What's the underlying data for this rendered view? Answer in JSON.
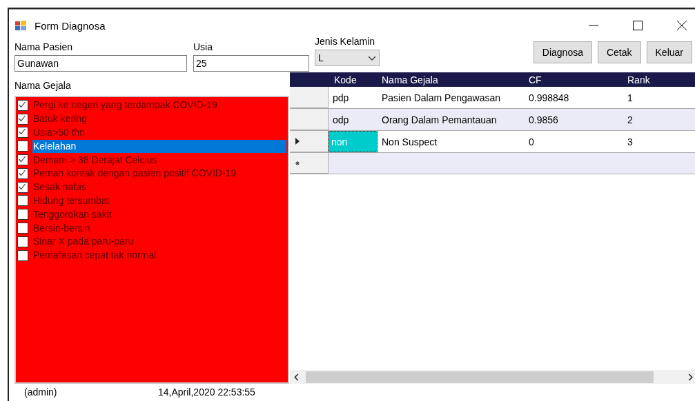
{
  "window": {
    "title": "Form Diagnosa"
  },
  "fields": [
    {
      "label": "Nama Pasien",
      "value": "Gunawan"
    },
    {
      "label": "Usia",
      "value": "25"
    }
  ],
  "gender": {
    "label": "Jenis Kelamin",
    "value": "L"
  },
  "buttons": [
    "Diagnosa",
    "Cetak",
    "Keluar"
  ],
  "symptoms": {
    "label": "Nama Gejala",
    "items": [
      {
        "text": "Pergi ke negeri yang terdampak COVID-19",
        "checked": true,
        "selected": false
      },
      {
        "text": "Batuk kering",
        "checked": true,
        "selected": false
      },
      {
        "text": "Usia>50 thn",
        "checked": true,
        "selected": false
      },
      {
        "text": "Kelelahan",
        "checked": false,
        "selected": true
      },
      {
        "text": "Demam > 38 Derajat Celcius",
        "checked": true,
        "selected": false
      },
      {
        "text": "Pemah kontak dengan pasien positif COVID-19",
        "checked": true,
        "selected": false
      },
      {
        "text": "Sesak nafas",
        "checked": true,
        "selected": false
      },
      {
        "text": "Hidung tersumbat",
        "checked": false,
        "selected": false
      },
      {
        "text": "Tenggorokan sakit",
        "checked": false,
        "selected": false
      },
      {
        "text": "Bersin-bersin",
        "checked": false,
        "selected": false
      },
      {
        "text": "Sinar X pada paru-paru",
        "checked": false,
        "selected": false
      },
      {
        "text": "Pemafasan cepat tak normal",
        "checked": false,
        "selected": false
      }
    ]
  },
  "table": {
    "columns": [
      "Kode",
      "Nama Gejala",
      "CF",
      "Rank"
    ],
    "rows": [
      {
        "cells": [
          "pdp",
          "Pasien Dalam Pengawasan",
          "0.998848",
          "1"
        ],
        "selected": false
      },
      {
        "cells": [
          "odp",
          "Orang Dalam Pemantauan",
          "0.9856",
          "2"
        ],
        "selected": false
      },
      {
        "cells": [
          "non",
          "Non Suspect",
          "0",
          "3"
        ],
        "selected": true
      }
    ]
  },
  "status_bar": {
    "user": "(admin)",
    "datetime": "14,April,2020 22:53:55"
  }
}
